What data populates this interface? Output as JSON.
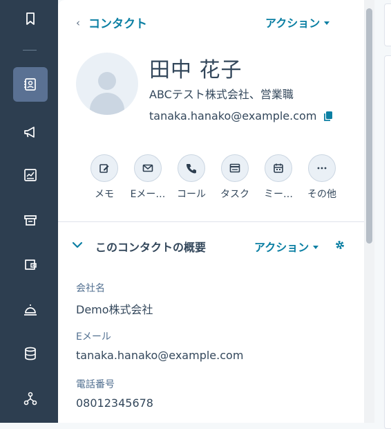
{
  "nav": {
    "items": [
      {
        "icon": "bookmark-icon"
      },
      {
        "icon": "contacts-icon",
        "active": true
      },
      {
        "icon": "megaphone-icon"
      },
      {
        "icon": "report-icon"
      },
      {
        "icon": "store-icon"
      },
      {
        "icon": "wallet-icon"
      },
      {
        "icon": "service-bell-icon"
      },
      {
        "icon": "database-icon"
      },
      {
        "icon": "workflow-icon"
      }
    ]
  },
  "header": {
    "back_label": "コンタクト",
    "actions_label": "アクション"
  },
  "contact": {
    "name": "田中 花子",
    "company_title": "ABCテスト株式会社、営業職",
    "email": "tanaka.hanako@example.com"
  },
  "quick_actions": [
    {
      "label": "メモ",
      "icon": "note-edit-icon"
    },
    {
      "label": "Eメー…",
      "icon": "email-icon"
    },
    {
      "label": "コール",
      "icon": "phone-icon"
    },
    {
      "label": "タスク",
      "icon": "task-icon"
    },
    {
      "label": "ミー…",
      "icon": "calendar-icon"
    },
    {
      "label": "その他",
      "icon": "more-icon"
    }
  ],
  "summary": {
    "title": "このコンタクトの概要",
    "actions_label": "アクション",
    "fields": [
      {
        "label": "会社名",
        "value": "Demo株式会社"
      },
      {
        "label": "Eメール",
        "value": "tanaka.hanako@example.com"
      },
      {
        "label": "電話番号",
        "value": "08012345678"
      }
    ]
  },
  "colors": {
    "nav_bg": "#2d3e50",
    "nav_active": "#5a7193",
    "accent": "#0b7fa3",
    "text": "#33475b"
  }
}
